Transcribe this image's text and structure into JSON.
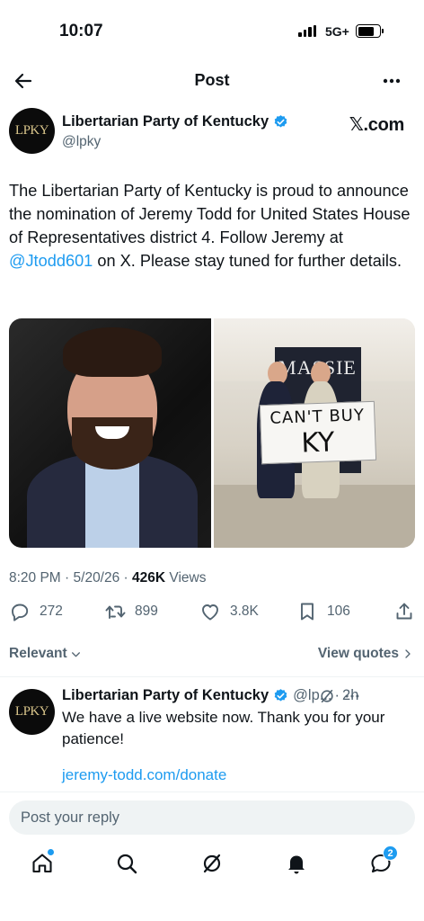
{
  "status_bar": {
    "time": "10:07",
    "network": "5G+"
  },
  "nav": {
    "title": "Post"
  },
  "tweet": {
    "author_name": "Libertarian Party of Kentucky",
    "author_handle": "@lpky",
    "avatar_text": "LPKY",
    "source": "𝕏.com",
    "text_before": "The Libertarian Party of Kentucky is proud to announce the nomination of Jeremy Todd for United States House of Representatives district 4. Follow Jeremy at ",
    "mention": "@Jtodd601",
    "text_after": " on X. Please stay tuned for further details.",
    "photo_right_banner": "MASSIE",
    "sign_line1": "CAN'T BUY",
    "sign_line2": "KY",
    "time": "8:20 PM",
    "date": "5/20/26",
    "views_count": "426K",
    "views_label": "Views"
  },
  "actions": {
    "replies": "272",
    "reposts": "899",
    "likes": "3.8K",
    "bookmarks": "106"
  },
  "replies_bar": {
    "sort_label": "Relevant",
    "view_quotes_label": "View quotes"
  },
  "reply": {
    "author_name": "Libertarian Party of Kentucky",
    "author_handle": "@lp...",
    "time": "2h",
    "avatar_text": "LPKY",
    "text": "We have a live website now. Thank you for your patience!",
    "link": "jeremy-todd.com/donate"
  },
  "composer": {
    "placeholder": "Post your reply"
  },
  "tabbar": {
    "messages_badge": "2"
  },
  "colors": {
    "accent": "#1d9bf0",
    "text": "#0f1419",
    "secondary": "#536471"
  }
}
